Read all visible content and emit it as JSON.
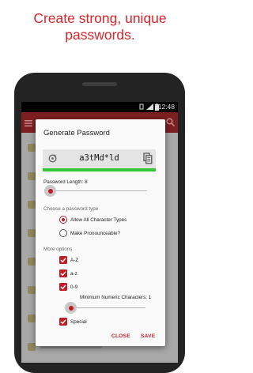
{
  "promo": {
    "line1": "Create strong, unique",
    "line2": "passwords."
  },
  "statusbar": {
    "time": "12:48"
  },
  "dialog": {
    "title": "Generate Password",
    "password": "a3tMd*ld",
    "length_label": "Password Length:",
    "length_value": "8",
    "type_heading": "Choose a password type",
    "type_options": [
      {
        "label": "Allow All Character Types",
        "checked": true
      },
      {
        "label": "Make Pronounceable?",
        "checked": false
      }
    ],
    "more_heading": "More options",
    "options": [
      {
        "label": "A-Z",
        "checked": true
      },
      {
        "label": "a-z",
        "checked": true
      },
      {
        "label": "0-9",
        "checked": true
      },
      {
        "label": "Special",
        "checked": true
      }
    ],
    "min_numeric_label": "Minimum Numeric Characters: 1",
    "close_label": "CLOSE",
    "save_label": "SAVE"
  },
  "colors": {
    "accent": "#c21d24",
    "strength_bar": "#34c634",
    "promo_text": "#d8262b"
  },
  "icons": [
    "menu-icon",
    "search-icon",
    "refresh-icon",
    "copy-icon",
    "signal-icon",
    "battery-icon"
  ]
}
